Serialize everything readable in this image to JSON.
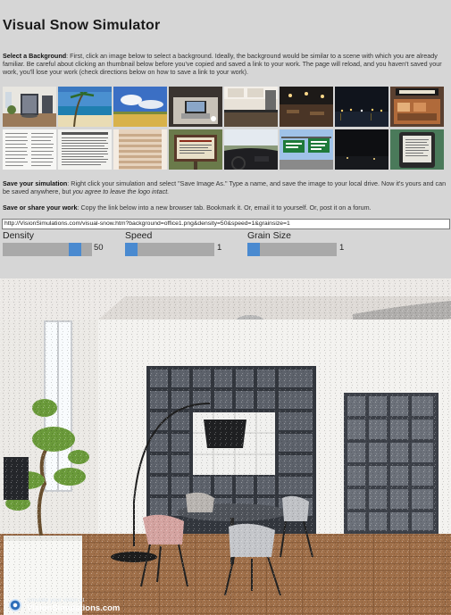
{
  "page": {
    "title": "Visual Snow Simulator"
  },
  "instructions": {
    "select": {
      "label": "Select a Background",
      "text": ": First, click an image below to select a background. Ideally, the background would be similar to a scene with which you are already familiar. Be careful about clicking an thumbnail below before you've copied and saved a link to your work. The page will reload, and you haven't saved your work, you'll lose your work (check directions below on how to save a link to your work)."
    },
    "save": {
      "label": "Save your simulation",
      "text": ": Right click your simulation and select \"Save Image As.\" Type a name, and save the image to your local drive. Now it's yours and can be saved anywhere, but ",
      "emphasis": "you agree to leave the logo intact."
    },
    "share": {
      "label": "Save or share your work",
      "text": ": Copy the link below into a new browser tab. Bookmark it. Or, email it to yourself. Or, post it on a forum."
    }
  },
  "thumbnails": {
    "row1": [
      {
        "name": "office-1",
        "icon": "office-icon"
      },
      {
        "name": "beach",
        "icon": "beach-icon"
      },
      {
        "name": "field-sky",
        "icon": "field-icon"
      },
      {
        "name": "desk-laptop",
        "icon": "desk-icon"
      },
      {
        "name": "kitchen",
        "icon": "kitchen-icon"
      },
      {
        "name": "restaurant-night",
        "icon": "restaurant-icon"
      },
      {
        "name": "night-harbor",
        "icon": "night-icon"
      },
      {
        "name": "bakery-sign",
        "icon": "sign-icon"
      }
    ],
    "row2": [
      {
        "name": "text-document-1",
        "icon": "document-icon"
      },
      {
        "name": "text-document-2",
        "icon": "document-icon"
      },
      {
        "name": "stairs",
        "icon": "stairs-icon"
      },
      {
        "name": "notice-board",
        "icon": "board-icon"
      },
      {
        "name": "car-dashboard",
        "icon": "car-icon"
      },
      {
        "name": "highway-signs",
        "icon": "highway-icon"
      },
      {
        "name": "night-sky",
        "icon": "dark-icon"
      },
      {
        "name": "e-reader",
        "icon": "ereader-icon"
      }
    ]
  },
  "link": {
    "url": "http://VisionSimulations.com/visual-snow.htm?background=office1.png&density=50&speed=1&grainsize=1"
  },
  "controls": {
    "density": {
      "label": "Density",
      "value": "50",
      "fraction": 0.86
    },
    "speed": {
      "label": "Speed",
      "value": "1",
      "fraction": 0.0
    },
    "grain": {
      "label": "Grain Size",
      "value": "1",
      "fraction": 0.0
    }
  },
  "simulation": {
    "watermark_small": "simulate your vision at",
    "watermark_brand": "VisionSimulations.com"
  },
  "colors": {
    "page_bg": "#d6d6d6",
    "slider_track": "#a9a9a9",
    "slider_knob": "#4a8ad0"
  }
}
